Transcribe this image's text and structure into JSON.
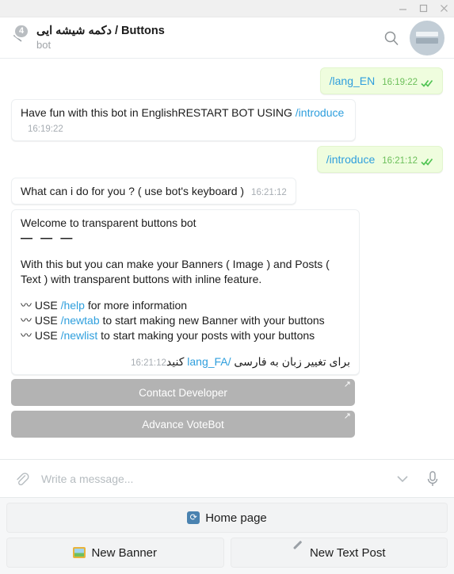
{
  "titlebar": {
    "minimize_label": "Minimize",
    "maximize_label": "Maximize",
    "close_label": "Close"
  },
  "header": {
    "unread_count": "4",
    "title": "دکمه شیشه ایی / Buttons",
    "subtitle": "bot",
    "search_label": "Search",
    "avatar_label": "Chat avatar"
  },
  "colors": {
    "outgoing_bubble": "#effdde",
    "incoming_bubble": "#ffffff",
    "link": "#2f9fdd",
    "tick": "#4fc352",
    "inline_button": "#b3b3b3",
    "badge": "#b9bdc1"
  },
  "messages": [
    {
      "direction": "out",
      "command": "/lang_EN",
      "time": "16:19:22",
      "ticks": "✓✓"
    },
    {
      "direction": "in",
      "line1": "Have fun with this bot in English",
      "line2_prefix": "RESTART BOT USING ",
      "line2_command": "/introduce",
      "time": "16:19:22"
    },
    {
      "direction": "out",
      "command": "/introduce",
      "time": "16:21:12",
      "ticks": "✓✓"
    },
    {
      "direction": "in",
      "text": "What can i do for you ? ( use bot's keyboard )",
      "time": "16:21:12"
    }
  ],
  "welcome_message": {
    "title": "Welcome to transparent buttons bot",
    "dashes": "— — —",
    "paragraph": "With this but you can make your Banners ( Image ) and Posts ( Text ) with transparent buttons with inline feature.",
    "bullets": [
      {
        "icon": "〰",
        "prefix": "USE ",
        "command": "/help",
        "suffix": " for more information"
      },
      {
        "icon": "〰",
        "prefix": "USE ",
        "command": "/newtab",
        "suffix": " to start making new Banner with your buttons"
      },
      {
        "icon": "〰",
        "prefix": "USE ",
        "command": "/newlist",
        "suffix": " to start making your posts with your buttons"
      }
    ],
    "rtl_before": "برای تغییر زبان به فارسی ",
    "rtl_command": "/lang_FA",
    "rtl_after": " کنید",
    "time": "16:21:12"
  },
  "inline_keyboard": [
    {
      "label": "Contact Developer",
      "external_icon": "↗"
    },
    {
      "label": "Advance VoteBot",
      "external_icon": "↗"
    }
  ],
  "input_bar": {
    "attach_label": "Attach file",
    "placeholder": "Write a message...",
    "value": "",
    "emoji_label": "Emoji",
    "mic_label": "Record voice message"
  },
  "reply_keyboard": {
    "rows": [
      [
        {
          "icon": "🔄",
          "label": "Home page"
        }
      ],
      [
        {
          "icon": "🖼",
          "label": "New Banner"
        },
        {
          "icon": "🖊",
          "label": "New Text Post"
        }
      ]
    ]
  }
}
